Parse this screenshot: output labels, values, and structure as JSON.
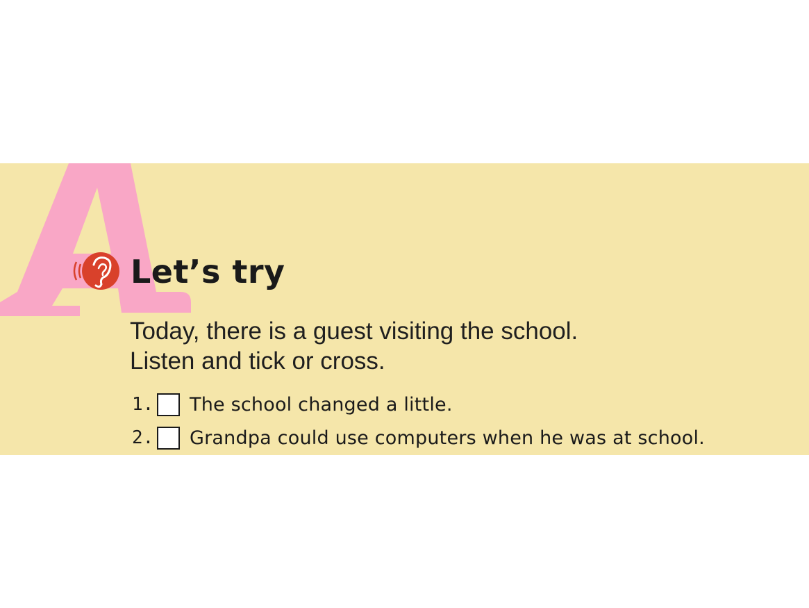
{
  "section": {
    "letter": "A",
    "title": "Let’s try",
    "instructions": [
      "Today, there is a guest visiting the school.",
      "Listen and tick or cross."
    ],
    "icon": "listening-ear-icon"
  },
  "items": [
    {
      "number": "1.",
      "text": "The school changed a little."
    },
    {
      "number": "2.",
      "text": "Grandpa could use computers when he was at school."
    }
  ],
  "colors": {
    "band": "#f5e6aa",
    "letter": "#f9a7c6",
    "icon": "#d9412b"
  }
}
